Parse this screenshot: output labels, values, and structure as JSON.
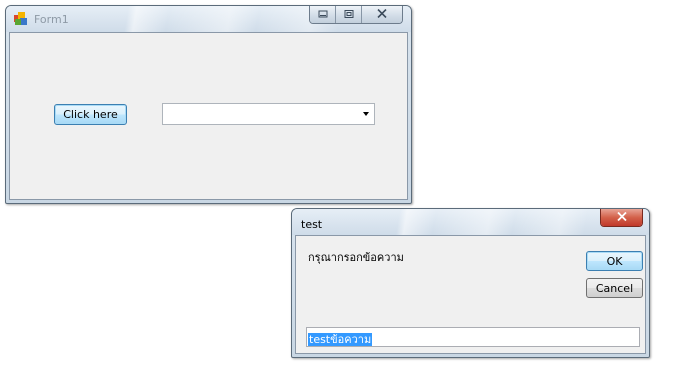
{
  "form1": {
    "title": "Form1",
    "click_button_label": "Click here",
    "combo_value": ""
  },
  "dialog": {
    "title": "test",
    "prompt": "กรุณากรอกข้อความ",
    "ok_label": "OK",
    "cancel_label": "Cancel",
    "input_value": "testข้อความ"
  },
  "icons": {
    "form1_app": "app-icon",
    "minimize": "minimize-icon",
    "maximize": "maximize-icon",
    "close": "close-icon",
    "dropdown": "chevron-down-icon"
  },
  "colors": {
    "selection": "#3399ff",
    "close_button": "#c0392b",
    "client_bg": "#f0f0f0"
  }
}
